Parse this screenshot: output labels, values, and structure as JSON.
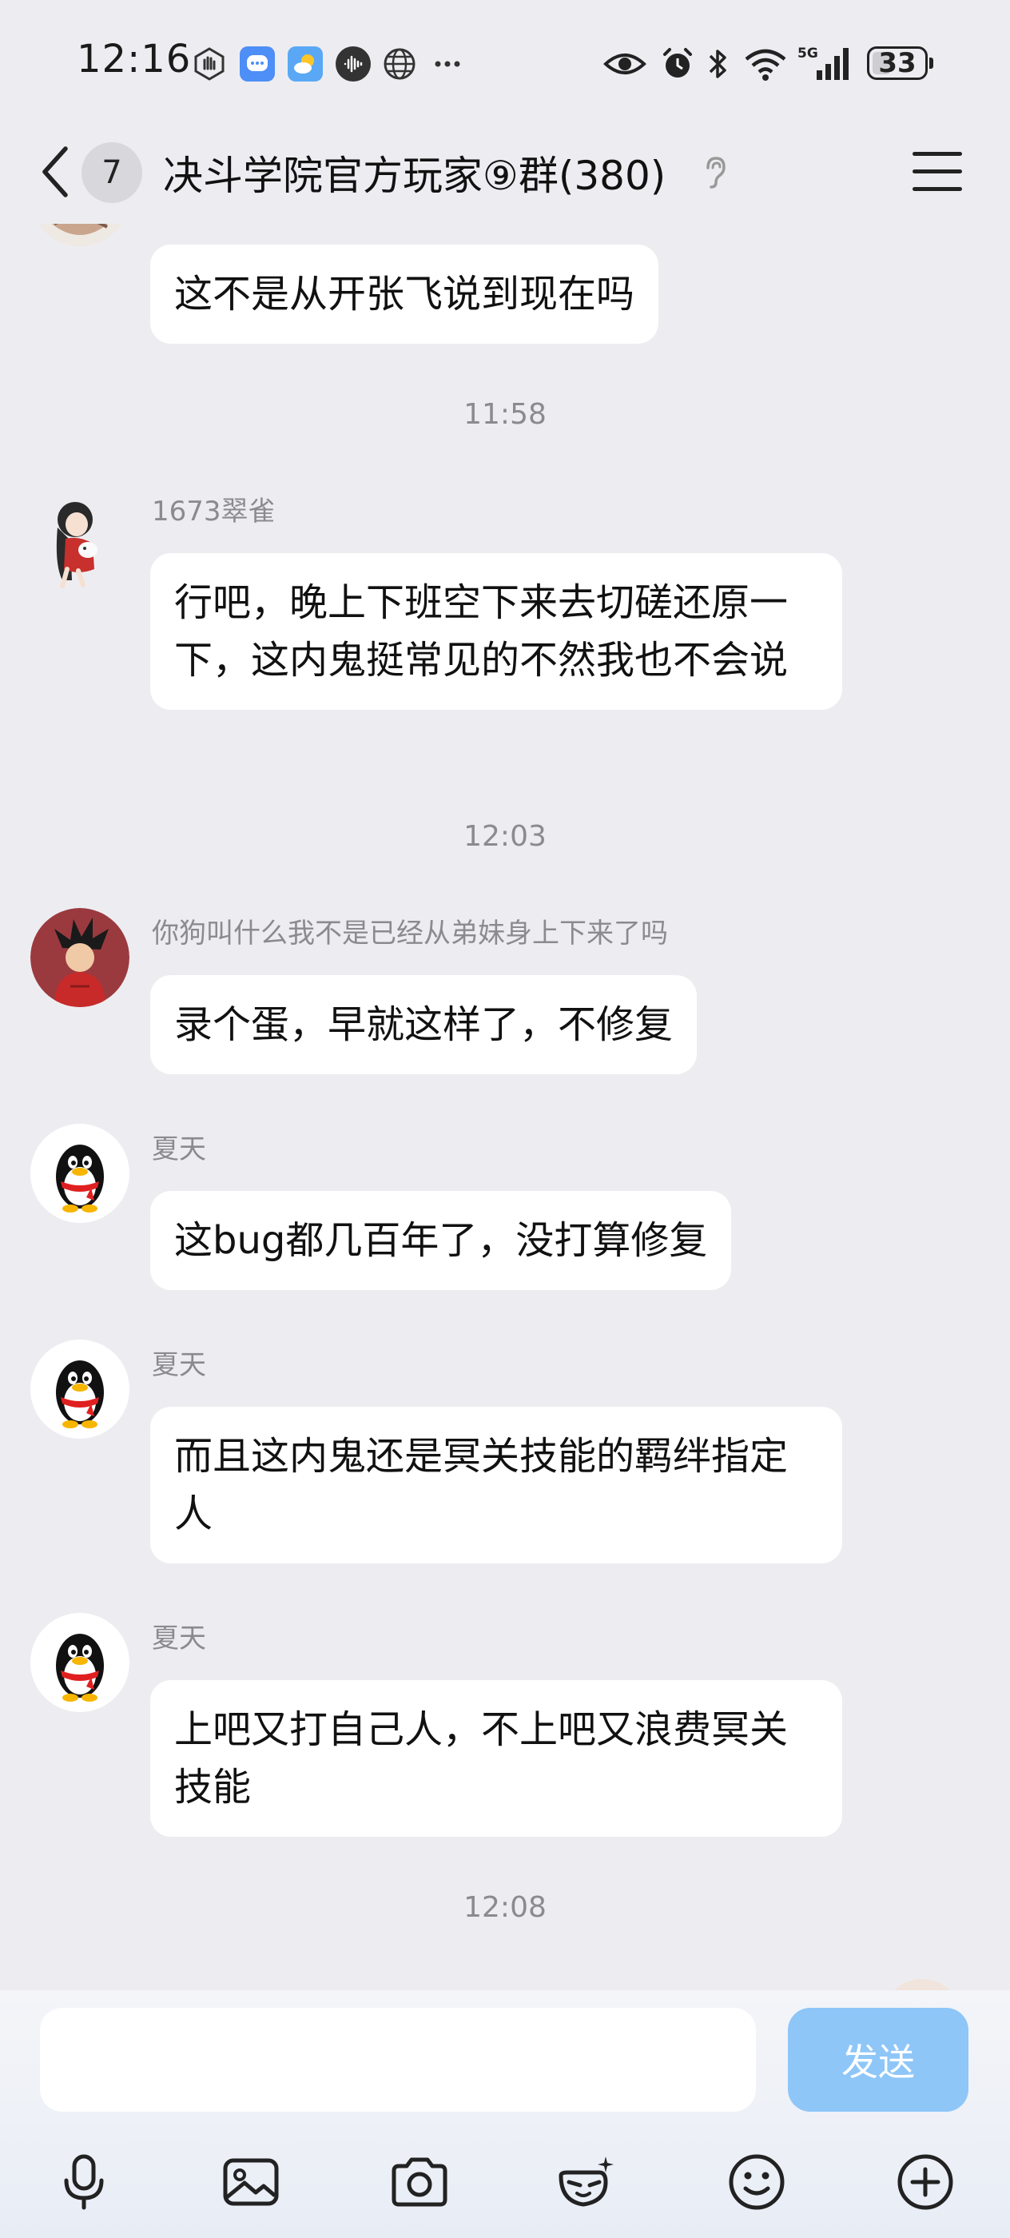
{
  "status_bar": {
    "time": "12:16",
    "battery": "33",
    "network": "5G"
  },
  "header": {
    "unread_count": "7",
    "title": "决斗学院官方玩家⑨群(380)"
  },
  "messages": [
    {
      "type": "message",
      "sender": "",
      "text": "这不是从开张飞说到现在吗"
    },
    {
      "type": "timestamp",
      "text": "11:58"
    },
    {
      "type": "message",
      "sender": "1673翠雀",
      "text": "行吧，晚上下班空下来去切磋还原一下，这内鬼挺常见的不然我也不会说"
    },
    {
      "type": "timestamp",
      "text": "12:03"
    },
    {
      "type": "message",
      "sender": "你狗叫什么我不是已经从弟妹身上下来了吗",
      "text": "录个蛋，早就这样了，不修复"
    },
    {
      "type": "message",
      "sender": "夏天",
      "text": "这bug都几百年了，没打算修复"
    },
    {
      "type": "message",
      "sender": "夏天",
      "text": "而且这内鬼还是冥关技能的羁绊指定人"
    },
    {
      "type": "message",
      "sender": "夏天",
      "text": "上吧又打自己人，不上吧又浪费冥关技能"
    },
    {
      "type": "timestamp",
      "text": "12:08"
    }
  ],
  "input": {
    "placeholder": "",
    "send_label": "发送"
  },
  "colors": {
    "background": "#ededf1",
    "bubble": "#ffffff",
    "send_button": "#8ec6f8",
    "meta_text": "#8a8a8f"
  },
  "icons": [
    "back-icon",
    "ear-icon",
    "menu-icon",
    "mic-icon",
    "image-icon",
    "camera-icon",
    "sticker-icon",
    "emoji-icon",
    "plus-icon"
  ]
}
